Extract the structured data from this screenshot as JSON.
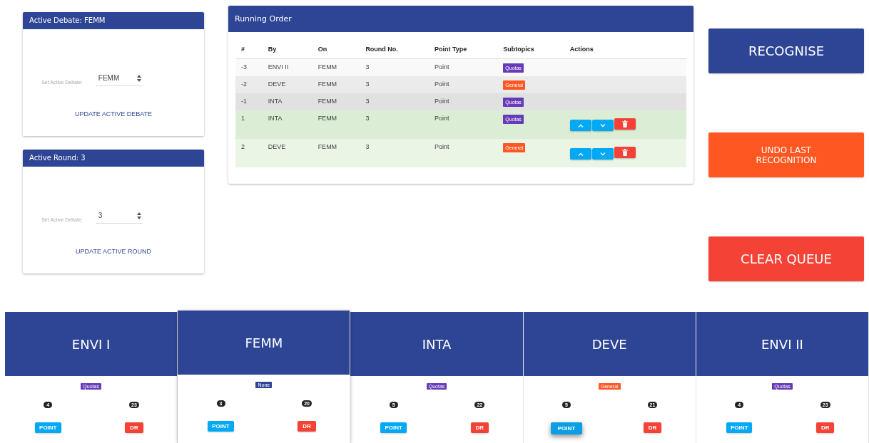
{
  "debate_card": {
    "title": "Active Debate: FEMM",
    "label": "Set Active Debate:",
    "value": "FEMM",
    "button": "UPDATE ACTIVE DEBATE"
  },
  "round_card": {
    "title": "Active Round: 3",
    "label": "Set Active Debate:",
    "value": "3",
    "button": "UPDATE ACTIVE ROUND"
  },
  "running_order": {
    "title": "Running Order",
    "columns": [
      "#",
      "By",
      "On",
      "Round No.",
      "Point Type",
      "Subtopics",
      "Actions"
    ],
    "rows": [
      {
        "kind": "done",
        "num": "-3",
        "by": "ENVI II",
        "on": "FEMM",
        "round": "3",
        "type": "Point",
        "subtopic": {
          "label": "Quotas",
          "color": "#673ab7"
        }
      },
      {
        "kind": "done",
        "num": "-2",
        "by": "DEVE",
        "on": "FEMM",
        "round": "3",
        "type": "Point",
        "subtopic": {
          "label": "General",
          "color": "#ff5722"
        }
      },
      {
        "kind": "done",
        "num": "-1",
        "by": "INTA",
        "on": "FEMM",
        "round": "3",
        "type": "Point",
        "subtopic": {
          "label": "Quotas",
          "color": "#673ab7"
        }
      },
      {
        "kind": "queued",
        "num": "1",
        "by": "INTA",
        "on": "FEMM",
        "round": "3",
        "type": "Point",
        "subtopic": {
          "label": "Quotas",
          "color": "#673ab7"
        }
      },
      {
        "kind": "queued",
        "num": "2",
        "by": "DEVE",
        "on": "FEMM",
        "round": "3",
        "type": "Point",
        "subtopic": {
          "label": "General",
          "color": "#ff5722"
        }
      }
    ]
  },
  "actions": [
    {
      "label": "RECOGNISE",
      "color": "#2e4595"
    },
    {
      "label": "UNDO LAST RECOGNITION",
      "color": "#ff5722"
    },
    {
      "label": "CLEAR QUEUE",
      "color": "#f44336"
    }
  ],
  "teams": [
    {
      "name": "ENVI I",
      "selected": false,
      "subtopic": {
        "label": "Quotas",
        "color": "#673ab7"
      },
      "points": "4",
      "drs": "23",
      "point_button": "POINT",
      "dr_button": "DR",
      "point_focused": false
    },
    {
      "name": "FEMM",
      "selected": true,
      "subtopic": {
        "label": "None",
        "color": "#2e4595"
      },
      "points": "3",
      "drs": "20",
      "point_button": "POINT",
      "dr_button": "DR",
      "point_focused": false
    },
    {
      "name": "INTA",
      "selected": false,
      "subtopic": {
        "label": "Quotas",
        "color": "#673ab7"
      },
      "points": "5",
      "drs": "22",
      "point_button": "POINT",
      "dr_button": "DR",
      "point_focused": false
    },
    {
      "name": "DEVE",
      "selected": false,
      "subtopic": {
        "label": "General",
        "color": "#ff5722"
      },
      "points": "5",
      "drs": "21",
      "point_button": "POINT",
      "dr_button": "DR",
      "point_focused": true
    },
    {
      "name": "ENVI II",
      "selected": false,
      "subtopic": {
        "label": "Quotas",
        "color": "#673ab7"
      },
      "points": "4",
      "drs": "23",
      "point_button": "POINT",
      "dr_button": "DR",
      "point_focused": false
    }
  ]
}
